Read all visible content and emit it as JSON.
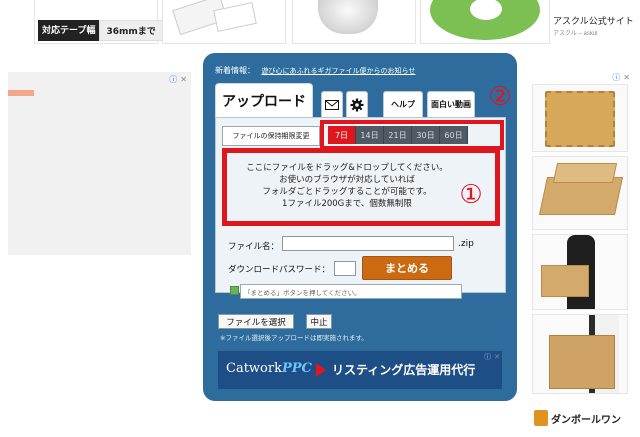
{
  "top_strip": {
    "tape_label_key": "対応テープ幅",
    "tape_label_value": "36mmまで",
    "askul_title": "アスクル公式サイト",
    "askul_sub": "アスクル – askul"
  },
  "ads": {
    "choice_symbol": "ⓘ",
    "close_symbol": "✕"
  },
  "panel": {
    "news_label": "新着情報：",
    "news_link": "遊び心にあふれるギガファイル便からのお知らせ",
    "title": "アップロード",
    "tab_help": "ヘルプ",
    "tab_fun": "面白い動画",
    "marker_two": "②",
    "marker_one": "①",
    "retention_label": "ファイルの保持期限変更",
    "days": [
      "7日",
      "14日",
      "21日",
      "30日",
      "60日"
    ],
    "selected_day": "7日",
    "drop_lines": [
      "ここにファイルをドラッグ&ドロップしてください。",
      "お使いのブラウザが対応していれば",
      "フォルダごとドラッグすることが可能です。",
      "1ファイル200Gまで、個数無制限"
    ],
    "file_name_label": "ファイル名：",
    "file_name_value": "",
    "zip_suffix": ".zip",
    "password_label": "ダウンロードパスワード：",
    "password_value": "",
    "matomeru_button": "まとめる",
    "matomeru_message": "「まとめる」ボタンを押してください。",
    "select_button": "ファイルを選択",
    "cancel_button": "中止",
    "note": "※ファイル選択後アップロードは即実施されます。"
  },
  "bottom_ad": {
    "logo_a": "Catwork",
    "logo_b": "PPC",
    "copy": "リスティング広告運用代行"
  },
  "brand": {
    "text": "ダンボールワン"
  },
  "colors": {
    "panel_blue": "#2d6c9c",
    "highlight_red": "#e0161e",
    "matomeru_orange": "#cc6a12"
  }
}
